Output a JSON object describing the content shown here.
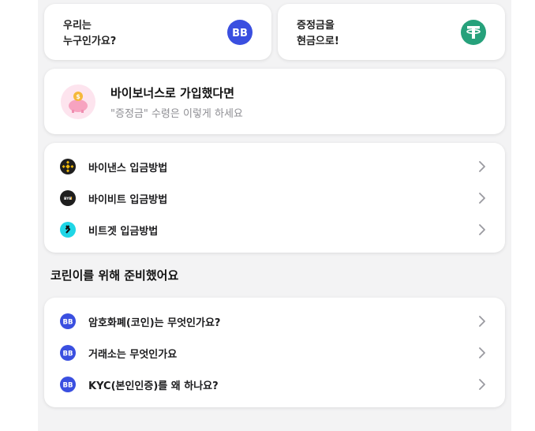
{
  "top_cards": {
    "about": {
      "label": "우리는\n누구인가요?",
      "icon": "bb-logo-icon"
    },
    "convert": {
      "label": "증정금을\n현금으로!",
      "icon": "tether-icon"
    }
  },
  "promo": {
    "title": "바이보너스로 가입했다면",
    "subtitle": "\"증정금\" 수령은 이렇게 하세요",
    "icon": "piggy-bank-icon"
  },
  "exchanges": [
    {
      "label": "바이낸스 입금방법",
      "icon": "binance-icon"
    },
    {
      "label": "바이비트 입금방법",
      "icon": "bybit-icon"
    },
    {
      "label": "비트겟 입금방법",
      "icon": "bitget-icon"
    }
  ],
  "section": {
    "title": "코린이를 위해 준비했어요"
  },
  "guides": [
    {
      "label": "암호화폐(코인)는 무엇인가요?",
      "icon": "bb-logo-icon"
    },
    {
      "label": "거래소는 무엇인가요",
      "icon": "bb-logo-icon"
    },
    {
      "label": "KYC(본인인증)를 왜 하나요?",
      "icon": "bb-logo-icon"
    }
  ],
  "colors": {
    "bb_blue": "#3a4fe0",
    "tether_green": "#26a17b",
    "binance_yellow": "#f0b90b",
    "bitget_cyan": "#1fd6e6",
    "piggy_pink": "#f7a3c0",
    "subtitle_gray": "#8e8e93",
    "background": "#f3f3f4"
  }
}
